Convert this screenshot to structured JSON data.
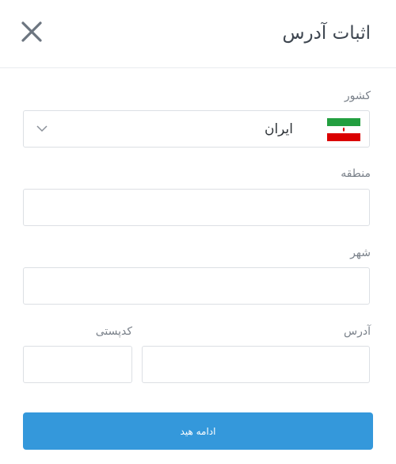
{
  "header": {
    "title": "اثبات آدرس",
    "close_icon": "close-icon"
  },
  "form": {
    "country": {
      "label": "کشور",
      "value": "ایران",
      "flag_icon": "iran-flag-icon",
      "dropdown_icon": "chevron-down-icon"
    },
    "region": {
      "label": "منطقه",
      "value": "",
      "placeholder": ""
    },
    "city": {
      "label": "شهر",
      "value": "",
      "placeholder": ""
    },
    "address": {
      "label": "آدرس",
      "value": "",
      "placeholder": ""
    },
    "postal_code": {
      "label": "کدپستی",
      "value": "",
      "placeholder": ""
    }
  },
  "submit": {
    "label": "ادامه هید"
  },
  "colors": {
    "accent": "#3498db",
    "border": "#dcdfe4",
    "flag_green": "#239f40",
    "flag_red": "#da0000"
  }
}
